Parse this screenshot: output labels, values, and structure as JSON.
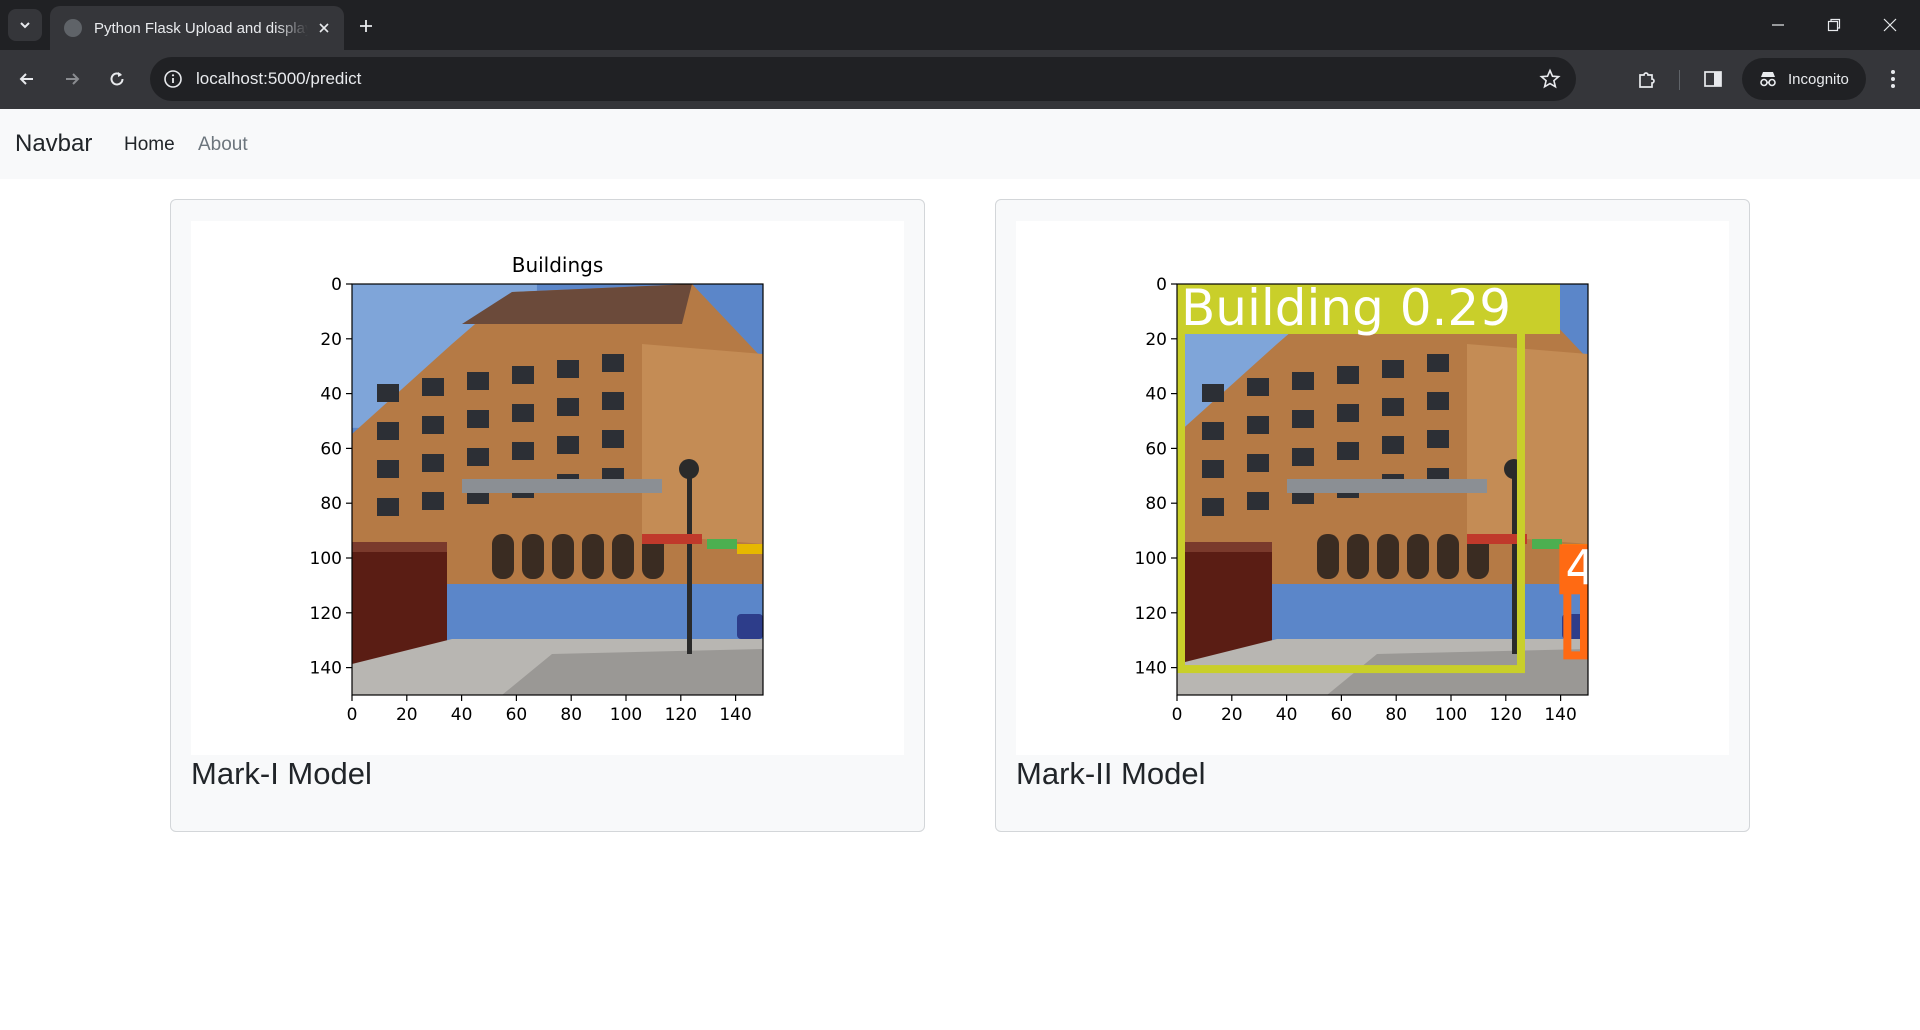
{
  "browser": {
    "tab_title": "Python Flask Upload and display image",
    "url": "localhost:5000/predict",
    "incognito_label": "Incognito"
  },
  "navbar": {
    "brand": "Navbar",
    "links": [
      "Home",
      "About"
    ]
  },
  "cards": [
    {
      "title": "Mark-I Model",
      "figure": {
        "title": "Buildings",
        "xticks": [
          "0",
          "20",
          "40",
          "60",
          "80",
          "100",
          "120",
          "140"
        ],
        "yticks": [
          "0",
          "20",
          "40",
          "60",
          "80",
          "100",
          "120",
          "140"
        ],
        "image_content": "building-photo"
      }
    },
    {
      "title": "Mark-II Model",
      "figure": {
        "title": "",
        "xticks": [
          "0",
          "20",
          "40",
          "60",
          "80",
          "100",
          "120",
          "140"
        ],
        "yticks": [
          "0",
          "20",
          "40",
          "60",
          "80",
          "100",
          "120",
          "140"
        ],
        "image_content": "building-photo",
        "detections": [
          {
            "label": "Building 0.29",
            "color": "#c9cf2a",
            "x1": 0,
            "y1": 0,
            "x2": 127,
            "y2": 142
          },
          {
            "label": "4",
            "color": "#ff6a13",
            "x1": 141,
            "y1": 95,
            "x2": 150,
            "y2": 137
          }
        ]
      }
    }
  ],
  "colors": {
    "chrome_dark": "#202124",
    "chrome_mid": "#35363a",
    "navbar_bg": "#f8f9fa",
    "building_box": "#c9cf2a",
    "car_box": "#ff6a13"
  }
}
